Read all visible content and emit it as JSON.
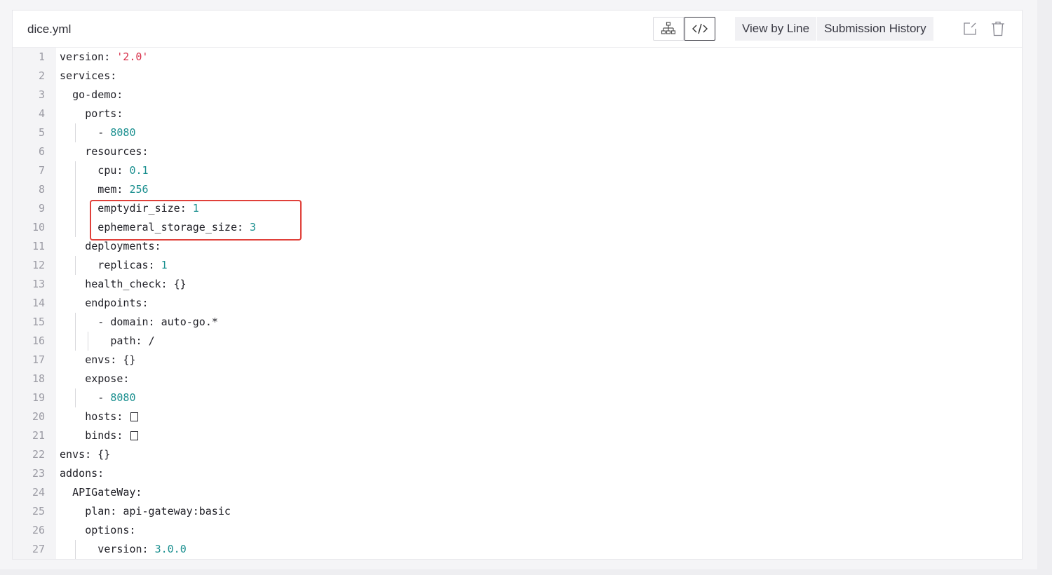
{
  "header": {
    "filename": "dice.yml",
    "view_tabs": [
      {
        "label": "View by Line"
      },
      {
        "label": "Submission History"
      }
    ],
    "icons": {
      "tree_view": "sitemap-icon",
      "code_view": "code-icon",
      "edit": "edit-icon",
      "delete": "trash-icon"
    }
  },
  "colors": {
    "number": "#1a8f8f",
    "string": "#d8314b",
    "highlight_border": "#e0403a"
  },
  "editor": {
    "lines": [
      {
        "n": "1",
        "indent": 0,
        "key": "version: ",
        "value": "'2.0'",
        "vtype": "str"
      },
      {
        "n": "2",
        "indent": 0,
        "key": "services:",
        "value": "",
        "vtype": ""
      },
      {
        "n": "3",
        "indent": 1,
        "key": "go-demo:",
        "value": "",
        "vtype": ""
      },
      {
        "n": "4",
        "indent": 2,
        "key": "ports:",
        "value": "",
        "vtype": ""
      },
      {
        "n": "5",
        "indent": 3,
        "key": "- ",
        "value": "8080",
        "vtype": "num"
      },
      {
        "n": "6",
        "indent": 2,
        "key": "resources:",
        "value": "",
        "vtype": ""
      },
      {
        "n": "7",
        "indent": 3,
        "key": "cpu: ",
        "value": "0.1",
        "vtype": "num"
      },
      {
        "n": "8",
        "indent": 3,
        "key": "mem: ",
        "value": "256",
        "vtype": "num"
      },
      {
        "n": "9",
        "indent": 3,
        "key": "emptydir_size: ",
        "value": "1",
        "vtype": "num"
      },
      {
        "n": "10",
        "indent": 3,
        "key": "ephemeral_storage_size: ",
        "value": "3",
        "vtype": "num"
      },
      {
        "n": "11",
        "indent": 2,
        "key": "deployments:",
        "value": "",
        "vtype": ""
      },
      {
        "n": "12",
        "indent": 3,
        "key": "replicas: ",
        "value": "1",
        "vtype": "num"
      },
      {
        "n": "13",
        "indent": 2,
        "key": "health_check: {}",
        "value": "",
        "vtype": ""
      },
      {
        "n": "14",
        "indent": 2,
        "key": "endpoints:",
        "value": "",
        "vtype": ""
      },
      {
        "n": "15",
        "indent": 3,
        "key": "- domain: auto-go.*",
        "value": "",
        "vtype": ""
      },
      {
        "n": "16",
        "indent": 4,
        "key": "path: /",
        "value": "",
        "vtype": ""
      },
      {
        "n": "17",
        "indent": 2,
        "key": "envs: {}",
        "value": "",
        "vtype": ""
      },
      {
        "n": "18",
        "indent": 2,
        "key": "expose:",
        "value": "",
        "vtype": ""
      },
      {
        "n": "19",
        "indent": 3,
        "key": "- ",
        "value": "8080",
        "vtype": "num"
      },
      {
        "n": "20",
        "indent": 2,
        "key": "hosts: ",
        "value": "",
        "vtype": "box"
      },
      {
        "n": "21",
        "indent": 2,
        "key": "binds: ",
        "value": "",
        "vtype": "box"
      },
      {
        "n": "22",
        "indent": 0,
        "key": "envs: {}",
        "value": "",
        "vtype": ""
      },
      {
        "n": "23",
        "indent": 0,
        "key": "addons:",
        "value": "",
        "vtype": ""
      },
      {
        "n": "24",
        "indent": 1,
        "key": "APIGateWay:",
        "value": "",
        "vtype": ""
      },
      {
        "n": "25",
        "indent": 2,
        "key": "plan: api-gateway:basic",
        "value": "",
        "vtype": ""
      },
      {
        "n": "26",
        "indent": 2,
        "key": "options:",
        "value": "",
        "vtype": ""
      },
      {
        "n": "27",
        "indent": 3,
        "key": "version: ",
        "value": "3.0.0",
        "vtype": "num"
      }
    ]
  }
}
